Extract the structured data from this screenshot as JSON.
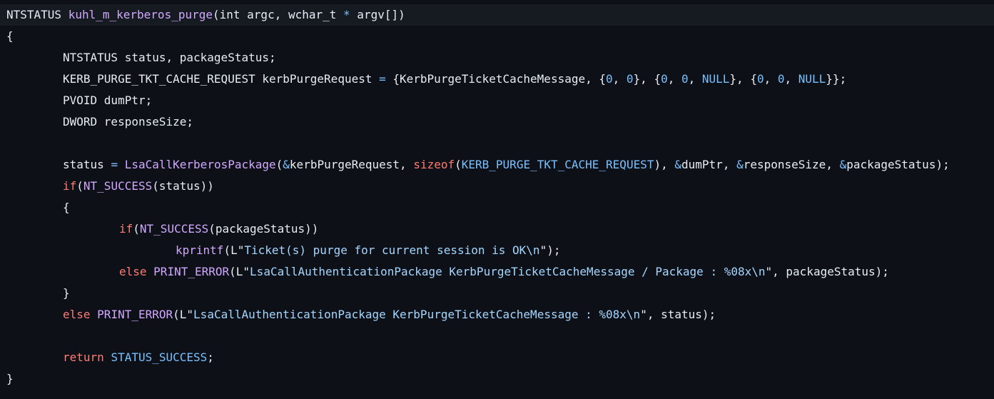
{
  "colors": {
    "background": "#0d1117",
    "highlight_line": "#161b22",
    "default": "#e6edf3",
    "function": "#d2a8ff",
    "keyword": "#ff7b72",
    "constant": "#79c0ff",
    "string": "#a5d6ff"
  },
  "code": {
    "lines": [
      {
        "indent": 0,
        "highlighted": true,
        "tokens": [
          {
            "t": "NTSTATUS ",
            "c": "default"
          },
          {
            "t": "kuhl_m_kerberos_purge",
            "c": "func"
          },
          {
            "t": "(int argc, wchar_t ",
            "c": "default"
          },
          {
            "t": "*",
            "c": "op"
          },
          {
            "t": " argv[])",
            "c": "default"
          }
        ]
      },
      {
        "indent": 0,
        "tokens": [
          {
            "t": "{",
            "c": "default"
          }
        ]
      },
      {
        "indent": 1,
        "tokens": [
          {
            "t": "NTSTATUS status, packageStatus;",
            "c": "default"
          }
        ]
      },
      {
        "indent": 1,
        "tokens": [
          {
            "t": "KERB_PURGE_TKT_CACHE_REQUEST kerbPurgeRequest ",
            "c": "default"
          },
          {
            "t": "=",
            "c": "op"
          },
          {
            "t": " {KerbPurgeTicketCacheMessage, {",
            "c": "default"
          },
          {
            "t": "0",
            "c": "const"
          },
          {
            "t": ", ",
            "c": "default"
          },
          {
            "t": "0",
            "c": "const"
          },
          {
            "t": "}, {",
            "c": "default"
          },
          {
            "t": "0",
            "c": "const"
          },
          {
            "t": ", ",
            "c": "default"
          },
          {
            "t": "0",
            "c": "const"
          },
          {
            "t": ", ",
            "c": "default"
          },
          {
            "t": "NULL",
            "c": "const"
          },
          {
            "t": "}, {",
            "c": "default"
          },
          {
            "t": "0",
            "c": "const"
          },
          {
            "t": ", ",
            "c": "default"
          },
          {
            "t": "0",
            "c": "const"
          },
          {
            "t": ", ",
            "c": "default"
          },
          {
            "t": "NULL",
            "c": "const"
          },
          {
            "t": "}};",
            "c": "default"
          }
        ]
      },
      {
        "indent": 1,
        "tokens": [
          {
            "t": "PVOID dumPtr;",
            "c": "default"
          }
        ]
      },
      {
        "indent": 1,
        "tokens": [
          {
            "t": "DWORD responseSize;",
            "c": "default"
          }
        ]
      },
      {
        "indent": 0,
        "tokens": []
      },
      {
        "indent": 1,
        "tokens": [
          {
            "t": "status ",
            "c": "default"
          },
          {
            "t": "=",
            "c": "op"
          },
          {
            "t": " ",
            "c": "default"
          },
          {
            "t": "LsaCallKerberosPackage",
            "c": "func"
          },
          {
            "t": "(",
            "c": "default"
          },
          {
            "t": "&",
            "c": "op"
          },
          {
            "t": "kerbPurgeRequest, ",
            "c": "default"
          },
          {
            "t": "sizeof",
            "c": "keyword"
          },
          {
            "t": "(",
            "c": "default"
          },
          {
            "t": "KERB_PURGE_TKT_CACHE_REQUEST",
            "c": "const"
          },
          {
            "t": "), ",
            "c": "default"
          },
          {
            "t": "&",
            "c": "op"
          },
          {
            "t": "dumPtr, ",
            "c": "default"
          },
          {
            "t": "&",
            "c": "op"
          },
          {
            "t": "responseSize, ",
            "c": "default"
          },
          {
            "t": "&",
            "c": "op"
          },
          {
            "t": "packageStatus);",
            "c": "default"
          }
        ]
      },
      {
        "indent": 1,
        "tokens": [
          {
            "t": "if",
            "c": "keyword"
          },
          {
            "t": "(",
            "c": "default"
          },
          {
            "t": "NT_SUCCESS",
            "c": "func"
          },
          {
            "t": "(status))",
            "c": "default"
          }
        ]
      },
      {
        "indent": 1,
        "tokens": [
          {
            "t": "{",
            "c": "default"
          }
        ]
      },
      {
        "indent": 2,
        "tokens": [
          {
            "t": "if",
            "c": "keyword"
          },
          {
            "t": "(",
            "c": "default"
          },
          {
            "t": "NT_SUCCESS",
            "c": "func"
          },
          {
            "t": "(packageStatus))",
            "c": "default"
          }
        ]
      },
      {
        "indent": 3,
        "tokens": [
          {
            "t": "kprintf",
            "c": "func"
          },
          {
            "t": "(",
            "c": "default"
          },
          {
            "t": "L\"",
            "c": "default"
          },
          {
            "t": "Ticket(s) purge for current session is OK\\n",
            "c": "string"
          },
          {
            "t": "\");",
            "c": "default"
          }
        ]
      },
      {
        "indent": 2,
        "tokens": [
          {
            "t": "else",
            "c": "keyword"
          },
          {
            "t": " ",
            "c": "default"
          },
          {
            "t": "PRINT_ERROR",
            "c": "func"
          },
          {
            "t": "(",
            "c": "default"
          },
          {
            "t": "L\"",
            "c": "default"
          },
          {
            "t": "LsaCallAuthenticationPackage KerbPurgeTicketCacheMessage / Package : %08x\\n",
            "c": "string"
          },
          {
            "t": "\", packageStatus);",
            "c": "default"
          }
        ]
      },
      {
        "indent": 1,
        "tokens": [
          {
            "t": "}",
            "c": "default"
          }
        ]
      },
      {
        "indent": 1,
        "tokens": [
          {
            "t": "else",
            "c": "keyword"
          },
          {
            "t": " ",
            "c": "default"
          },
          {
            "t": "PRINT_ERROR",
            "c": "func"
          },
          {
            "t": "(",
            "c": "default"
          },
          {
            "t": "L\"",
            "c": "default"
          },
          {
            "t": "LsaCallAuthenticationPackage KerbPurgeTicketCacheMessage : %08x\\n",
            "c": "string"
          },
          {
            "t": "\", status);",
            "c": "default"
          }
        ]
      },
      {
        "indent": 0,
        "tokens": []
      },
      {
        "indent": 1,
        "tokens": [
          {
            "t": "return",
            "c": "keyword"
          },
          {
            "t": " ",
            "c": "default"
          },
          {
            "t": "STATUS_SUCCESS",
            "c": "const"
          },
          {
            "t": ";",
            "c": "default"
          }
        ]
      },
      {
        "indent": 0,
        "tokens": [
          {
            "t": "}",
            "c": "default"
          }
        ]
      }
    ]
  }
}
